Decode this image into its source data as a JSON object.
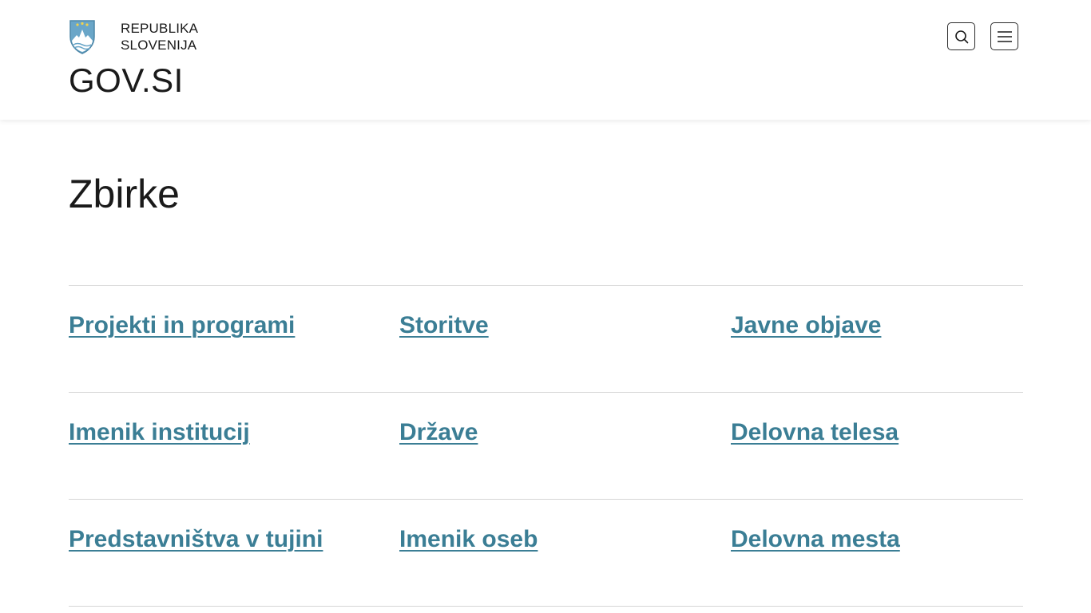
{
  "header": {
    "republic_line1": "REPUBLIKA",
    "republic_line2": "SLOVENIJA",
    "site_title": "GOV.SI",
    "search_icon": "search-icon",
    "menu_icon": "hamburger-menu-icon"
  },
  "main": {
    "page_title": "Zbirke",
    "collections": [
      [
        "Projekti in programi",
        "Storitve",
        "Javne objave"
      ],
      [
        "Imenik institucij",
        "Države",
        "Delovna telesa"
      ],
      [
        "Predstavništva v tujini",
        "Imenik oseb",
        "Delovna mesta"
      ]
    ]
  },
  "colors": {
    "link": "#3b7e95",
    "crest_blue": "#6aa6c8",
    "divider": "#d5d5d5"
  }
}
